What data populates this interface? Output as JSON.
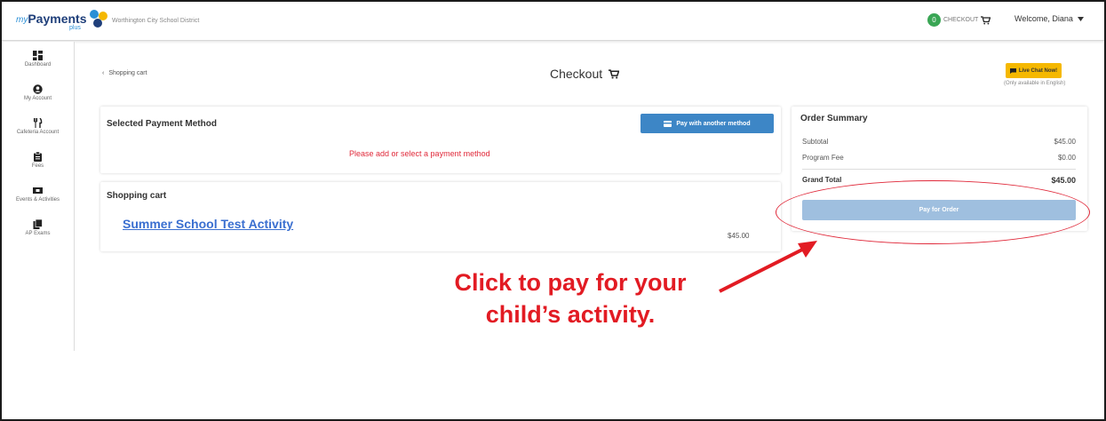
{
  "header": {
    "logo_my": "my",
    "logo_payments": "Payments",
    "logo_plus": "plus",
    "district": "Worthington City School District",
    "cart_count": "0",
    "checkout_label": "CHECKOUT",
    "welcome": "Welcome, Diana"
  },
  "sidebar": {
    "items": [
      {
        "label": "Dashboard",
        "icon": "dashboard-icon"
      },
      {
        "label": "My Account",
        "icon": "account-icon"
      },
      {
        "label": "Cafeteria Account",
        "icon": "utensils-icon"
      },
      {
        "label": "Fees",
        "icon": "clipboard-icon"
      },
      {
        "label": "Events & Activities",
        "icon": "ticket-icon"
      },
      {
        "label": "AP Exams",
        "icon": "books-icon"
      }
    ]
  },
  "main": {
    "back_label": "Shopping cart",
    "title": "Checkout",
    "live_chat": "Live Chat Now!",
    "live_chat_note": "(Only available in English)"
  },
  "payment_method": {
    "title": "Selected Payment Method",
    "button": "Pay with another method",
    "warning": "Please add or select a payment method"
  },
  "cart": {
    "title": "Shopping cart",
    "item_name": "Summer School Test Activity",
    "item_price": "$45.00"
  },
  "summary": {
    "title": "Order Summary",
    "subtotal_label": "Subtotal",
    "subtotal_value": "$45.00",
    "fee_label": "Program Fee",
    "fee_value": "$0.00",
    "total_label": "Grand Total",
    "total_value": "$45.00",
    "pay_button": "Pay for Order"
  },
  "annotation": {
    "line1": "Click to pay for your",
    "line2": "child’s activity."
  },
  "colors": {
    "accent_blue": "#3d86c6",
    "disabled_blue": "#9fbfdf",
    "warning_red": "#e0293a",
    "chat_yellow": "#f5b800",
    "annotation_red": "#e21b23"
  }
}
